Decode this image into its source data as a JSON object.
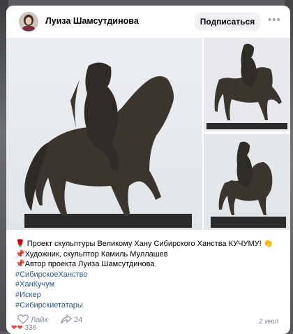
{
  "post": {
    "author": "Луиза Шамсутдинова",
    "subscribe_label": "Подписаться",
    "more_label": "•••",
    "lines": [
      {
        "emoji": "🌹",
        "text": "Проект скульптуры Великому Хану Сибирского Ханства КУЧУМУ! 👏"
      },
      {
        "emoji": "📌",
        "text": "Художник, скульптор Камиль Муллашев"
      },
      {
        "emoji": "📌",
        "text": "Автор проекта Луиза Шамсутдинова"
      }
    ],
    "hashtags": [
      "#СибирскоеХанство",
      "#ХанКучум",
      "#Искер",
      "#Сибирскиетатары"
    ],
    "like_label": "Лайк",
    "share_count": "24",
    "date": "2 июл",
    "reactions_count": "336"
  },
  "colors": {
    "link": "#2a5885",
    "muted": "#818c99",
    "button_bg": "#f0f2f5"
  }
}
